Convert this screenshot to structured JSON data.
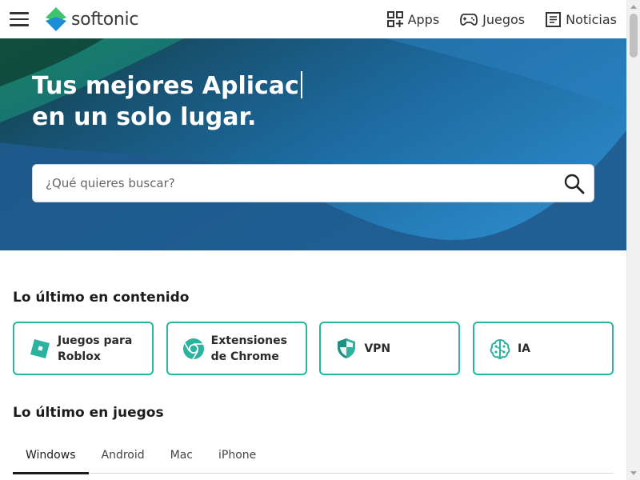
{
  "header": {
    "logo_text": "softonic",
    "menu_icon": "hamburger-icon",
    "nav": [
      {
        "label": "Apps",
        "icon": "apps-grid-icon"
      },
      {
        "label": "Juegos",
        "icon": "gamepad-icon"
      },
      {
        "label": "Noticias",
        "icon": "newspaper-icon"
      }
    ]
  },
  "hero": {
    "title_line1": "Tus mejores Aplicac",
    "title_line2": "en un solo lugar.",
    "search_placeholder": "¿Qué quieres buscar?",
    "search_icon": "search-icon"
  },
  "latest_content": {
    "title": "Lo último en contenido",
    "cards": [
      {
        "line1": "Juegos para",
        "line2": "Roblox",
        "icon": "roblox-icon"
      },
      {
        "line1": "Extensiones",
        "line2": "de Chrome",
        "icon": "chrome-icon"
      },
      {
        "line1": "VPN",
        "line2": "",
        "icon": "shield-icon"
      },
      {
        "line1": "IA",
        "line2": "",
        "icon": "ai-brain-icon"
      }
    ]
  },
  "latest_games": {
    "title": "Lo último en juegos",
    "tabs": [
      "Windows",
      "Android",
      "Mac",
      "iPhone"
    ],
    "active_tab": "Windows"
  },
  "colors": {
    "accent_teal": "#27b59c",
    "hero_blue": "#1f6aa0",
    "logo_green": "#3ec46d",
    "logo_blue": "#1b8fd6"
  }
}
